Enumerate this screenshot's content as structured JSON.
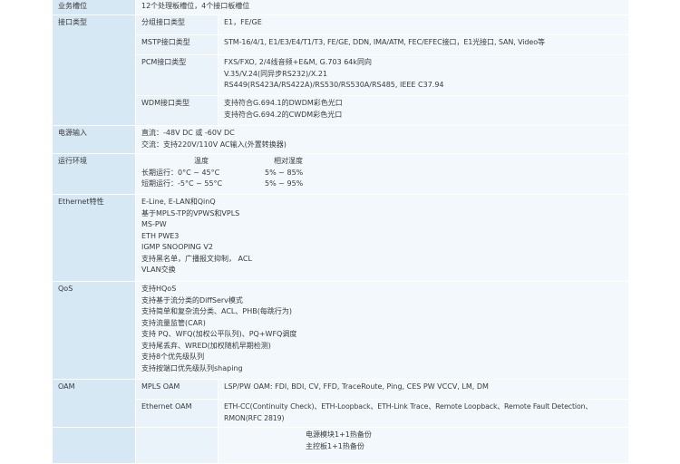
{
  "rows": {
    "slots": {
      "label": "业务槽位",
      "value": "12个处理板槽位，4个接口板槽位"
    },
    "interface": {
      "label": "接口类型",
      "group": {
        "sub": "分组接口类型",
        "value": "E1，FE/GE"
      },
      "mstp": {
        "sub": "MSTP接口类型",
        "value": "STM-16/4/1, E1/E3/E4/T1/T3, FE/GE, DDN, IMA/ATM, FEC/EFEC接口，E1光接口, SAN, Video等"
      },
      "pcm": {
        "sub": "PCM接口类型",
        "lines": [
          "FXS/FXO, 2/4线音频+E&M, G.703 64k同向",
          "V.35/V.24(同异步RS232)/X.21",
          "RS449(RS423A/RS422A)/RS530/RS530A/RS485, IEEE C37.94"
        ]
      },
      "wdm": {
        "sub": "WDM接口类型",
        "lines": [
          "支持符合G.694.1的DWDM彩色光口",
          "支持符合G.694.2的CWDM彩色光口"
        ]
      }
    },
    "power": {
      "label": "电源输入",
      "lines": [
        "直流：-48V DC 或 -60V DC",
        "交流：支持220V/110V AC输入(外置转换器)"
      ]
    },
    "environment": {
      "label": "运行环境",
      "header_temp": "温度",
      "header_humidity": "相对湿度",
      "long_term": {
        "temp": "长期运行：0°C ~ 45°C",
        "humidity": "5% ~ 85%"
      },
      "short_term": {
        "temp": "短期运行：-5°C ~ 55°C",
        "humidity": "5% ~ 95%"
      }
    },
    "ethernet": {
      "label": "Ethernet特性",
      "lines": [
        "E-Line, E-LAN和QinQ",
        "基于MPLS-TP的VPWS和VPLS",
        "MS-PW",
        "ETH PWE3",
        "IGMP SNOOPING V2",
        "支持黑名单，广播报文抑制， ACL",
        "VLAN交换"
      ]
    },
    "qos": {
      "label": "QoS",
      "lines": [
        "支持HQoS",
        "支持基于流分类的DiffServ模式",
        "支持简单和复杂流分类、ACL、PHB(每跳行为)",
        "支持流量监管(CAR)",
        "支持 PQ、WFQ(加权公平队列)、PQ+WFQ调度",
        "支持尾丢弃、WRED(加权随机早期检测)",
        "支持8个优先级队列",
        "支持按端口优先级队列shaping"
      ]
    },
    "oam": {
      "label": "OAM",
      "mpls": {
        "sub": "MPLS OAM",
        "value": "LSP/PW OAM: FDI, BDI, CV, FFD, TraceRoute, Ping, CES PW VCCV, LM, DM"
      },
      "ethernet": {
        "sub": "Ethernet OAM",
        "lines": [
          "ETH-CC(Continuity Check)、ETH-Loopback、ETH-Link Trace、Remote Loopback、Remote Fault Detection、",
          "RMON(RFC 2819)"
        ]
      }
    },
    "reliability": {
      "lines": [
        "电源模块1+1热备份",
        "主控板1+1热备份"
      ]
    }
  }
}
